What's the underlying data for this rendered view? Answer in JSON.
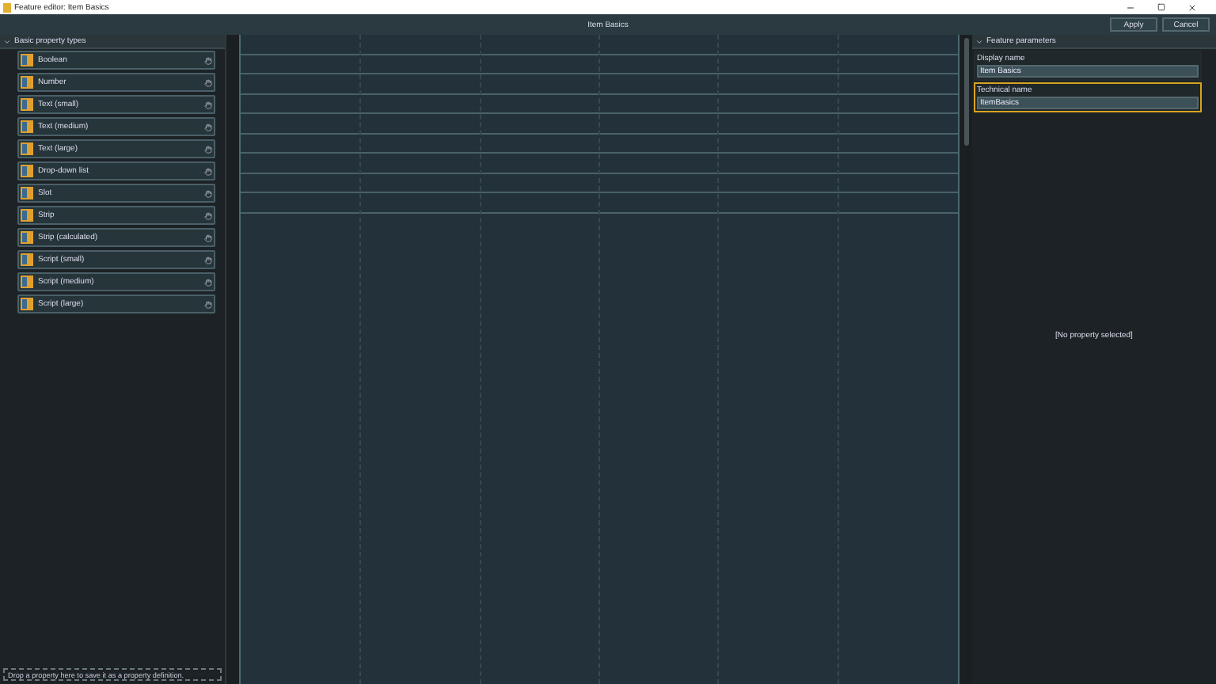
{
  "window": {
    "title": "Feature editor: Item Basics"
  },
  "toolbar": {
    "title": "Item Basics",
    "buttons": [
      "Apply",
      "Cancel"
    ]
  },
  "left_panel": {
    "header": "Basic property types",
    "expanded": true,
    "items": [
      {
        "label": "Boolean"
      },
      {
        "label": "Number"
      },
      {
        "label": "Text (small)"
      },
      {
        "label": "Text (medium)"
      },
      {
        "label": "Text (large)"
      },
      {
        "label": "Drop-down list"
      },
      {
        "label": "Slot"
      },
      {
        "label": "Strip"
      },
      {
        "label": "Strip (calculated)"
      },
      {
        "label": "Script (small)"
      },
      {
        "label": "Script (medium)"
      },
      {
        "label": "Script (large)"
      }
    ],
    "drop_hint": "Drop a property here to save it as a property definition."
  },
  "right_panel": {
    "header": "Feature parameters",
    "expanded": true,
    "fields": [
      {
        "label": "Display name",
        "value": "Item Basics",
        "highlighted": false
      },
      {
        "label": "Technical name",
        "value": "ItemBasics",
        "highlighted": true
      }
    ],
    "empty_message": "[No property selected]"
  }
}
